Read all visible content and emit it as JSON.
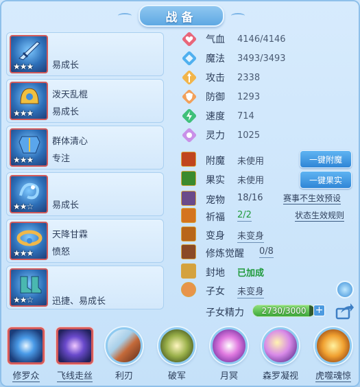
{
  "title": "战备",
  "equipment": [
    {
      "name": "",
      "trait": "易成长",
      "stars": 3,
      "max_stars": 3,
      "icon": "sword-icon"
    },
    {
      "name": "泼天乱棍",
      "trait": "易成长",
      "stars": 3,
      "max_stars": 3,
      "icon": "helmet-icon"
    },
    {
      "name": "群体清心",
      "trait": "专注",
      "stars": 3,
      "max_stars": 3,
      "icon": "armor-icon"
    },
    {
      "name": "",
      "trait": "易成长",
      "stars": 2,
      "max_stars": 3,
      "icon": "dragon-icon"
    },
    {
      "name": "天降甘霖",
      "trait": "愤怒",
      "stars": 3,
      "max_stars": 3,
      "icon": "belt-icon"
    },
    {
      "name": "",
      "trait": "迅捷、易成长",
      "stars": 2,
      "max_stars": 3,
      "icon": "boots-icon"
    }
  ],
  "stats": [
    {
      "label": "气血",
      "value": "4146/4146",
      "icon": "heart-icon",
      "color": "#e8667a"
    },
    {
      "label": "魔法",
      "value": "3493/3493",
      "icon": "diamond-icon",
      "color": "#4fb0ef"
    },
    {
      "label": "攻击",
      "value": "2338",
      "icon": "sword-up-icon",
      "color": "#f2b54a"
    },
    {
      "label": "防御",
      "value": "1293",
      "icon": "shield-icon",
      "color": "#f2a05a"
    },
    {
      "label": "速度",
      "value": "714",
      "icon": "lightning-icon",
      "color": "#3fc07a"
    },
    {
      "label": "灵力",
      "value": "1025",
      "icon": "spirit-icon",
      "color": "#c990e8"
    }
  ],
  "features": {
    "enchant": {
      "label": "附魔",
      "value": "未使用"
    },
    "fruit": {
      "label": "果实",
      "value": "未使用"
    },
    "pet": {
      "label": "宠物",
      "value": "18/16"
    },
    "pray": {
      "label": "祈福",
      "value": "2/2"
    },
    "transform": {
      "label": "变身",
      "value": "未变身"
    },
    "awaken": {
      "label": "修炼觉醒",
      "value": "0/8"
    },
    "land": {
      "label": "封地",
      "value": "已加成"
    },
    "child": {
      "label": "子女",
      "value": "未变身"
    },
    "child_energy": {
      "label": "子女精力",
      "value": "2730/3000",
      "fraction": 0.91
    }
  },
  "buttons": {
    "enchant": "一键附魔",
    "fruit": "一键果实",
    "event_preset": "赛事不生效预设",
    "status_rules": "状态生效规则"
  },
  "skills": [
    {
      "name": "修罗众",
      "icon": "vortex-icon",
      "frame": "square",
      "underline": true
    },
    {
      "name": "飞线走丝",
      "icon": "spider-icon",
      "frame": "square",
      "underline": true
    },
    {
      "name": "利刃",
      "icon": "blade-icon",
      "frame": "orb",
      "underline": false
    },
    {
      "name": "破军",
      "icon": "spear-icon",
      "frame": "orb",
      "underline": false
    },
    {
      "name": "月冥",
      "icon": "moon-orb-icon",
      "frame": "orb",
      "underline": false
    },
    {
      "name": "森罗凝视",
      "icon": "crescent-icon",
      "frame": "orb",
      "underline": false
    },
    {
      "name": "虎噬魂惊",
      "icon": "tiger-icon",
      "frame": "orb",
      "underline": false
    }
  ]
}
